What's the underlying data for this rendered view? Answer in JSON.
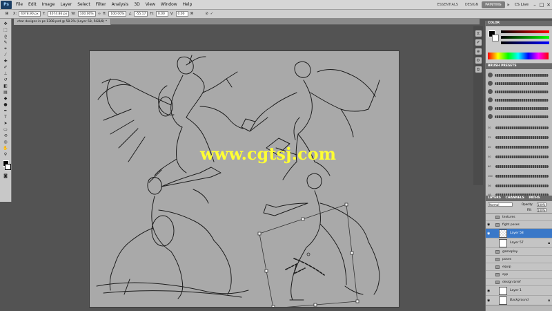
{
  "menubar": {
    "logo": "Ps",
    "items": [
      "File",
      "Edit",
      "Image",
      "Layer",
      "Select",
      "Filter",
      "Analysis",
      "3D",
      "View",
      "Window",
      "Help"
    ],
    "workspaces": [
      "ESSENTIALS",
      "DESIGN",
      "PAINTING"
    ],
    "active_workspace": "PAINTING",
    "cs_live": "CS Live"
  },
  "options": {
    "x": "4078.90 px",
    "y": "4074.86 px",
    "w_label": "W:",
    "w": "100.00%",
    "h_label": "H:",
    "h": "100.00%",
    "angle": "-55.17",
    "h2_label": "H:",
    "h_skew": "0.00",
    "v_label": "V:",
    "v_skew": "0.00"
  },
  "document": {
    "tab_title": "char designs in ps 1308.psd @ 58.2% (Layer 58, RGB/8) *"
  },
  "watermark": "www.cgtsj.com",
  "panels": {
    "color": {
      "title": "COLOR"
    },
    "brush": {
      "title": "BRUSH PRESETS",
      "sizes": [
        "30",
        "25",
        "40",
        "50",
        "60",
        "100",
        "36",
        "48",
        "40",
        "60"
      ]
    },
    "layers": {
      "tabs": [
        "LAYERS",
        "CHANNELS",
        "PATHS"
      ],
      "blend_mode": "Normal",
      "opacity_label": "Opacity:",
      "opacity": "100%",
      "fill_label": "Fill:",
      "fill": "100%",
      "rows": [
        {
          "name": "textures",
          "kind": "folder",
          "visible": false
        },
        {
          "name": "fight poses",
          "kind": "folder",
          "visible": true
        },
        {
          "name": "Layer 58",
          "kind": "layer",
          "visible": true,
          "selected": true
        },
        {
          "name": "Layer 57",
          "kind": "layer",
          "visible": false,
          "locked": true
        },
        {
          "name": "gameplay",
          "kind": "folder",
          "visible": false
        },
        {
          "name": "poses",
          "kind": "folder",
          "visible": false
        },
        {
          "name": "equip",
          "kind": "folder",
          "visible": false
        },
        {
          "name": "eyp",
          "kind": "folder",
          "visible": false
        },
        {
          "name": "design brief",
          "kind": "folder",
          "visible": false
        },
        {
          "name": "Layer 1",
          "kind": "layer",
          "visible": true
        },
        {
          "name": "Background",
          "kind": "layer",
          "visible": true,
          "locked": true
        }
      ]
    }
  },
  "colors": {
    "canvas_bg": "#a9a9a9",
    "watermark": "#ffff33",
    "selected_layer": "#3a78c8"
  }
}
